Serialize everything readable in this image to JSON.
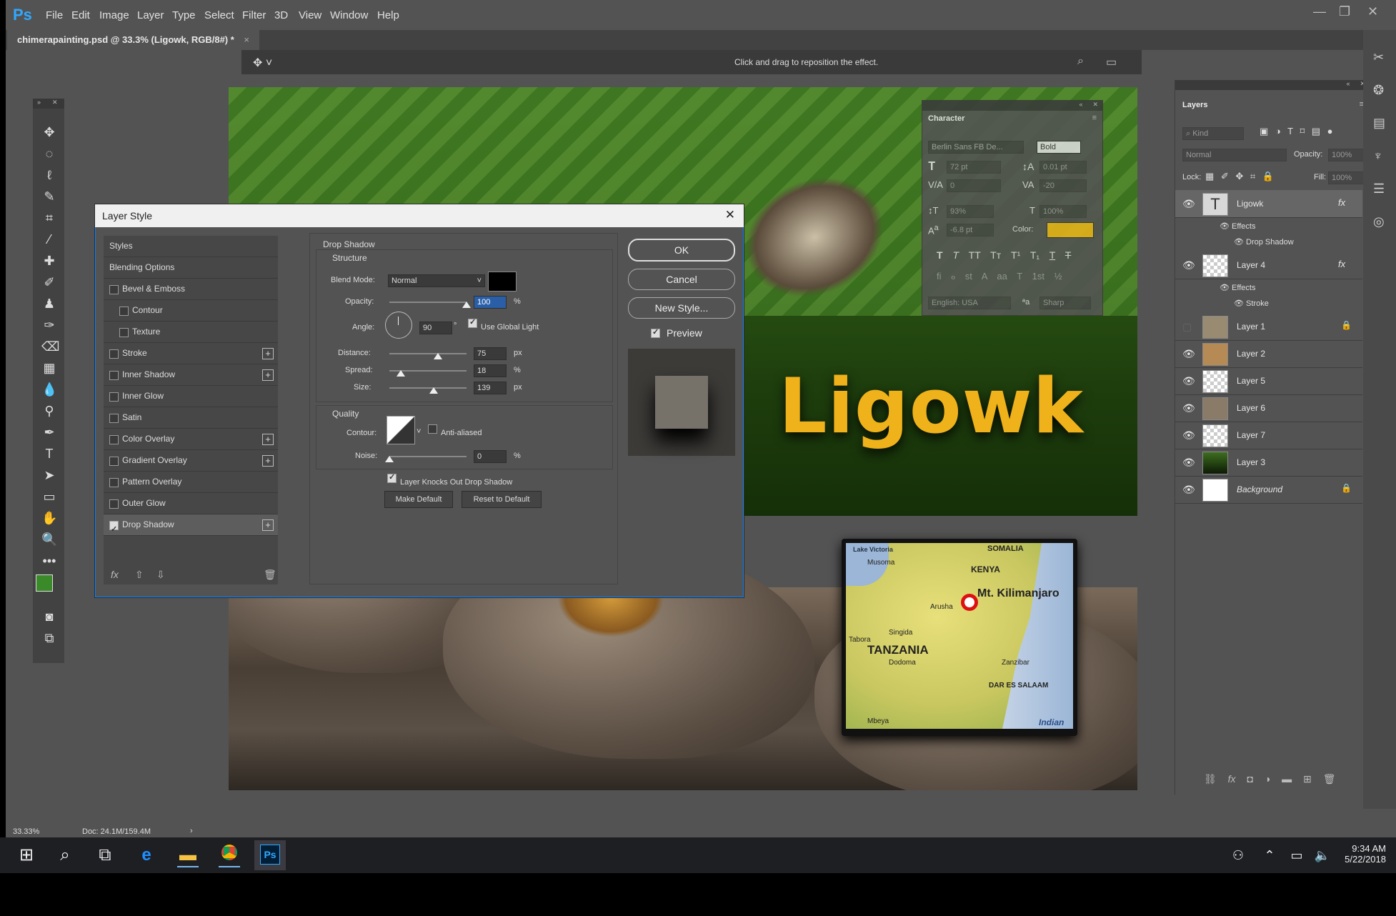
{
  "app": {
    "logo": "Ps",
    "menu": [
      "File",
      "Edit",
      "Image",
      "Layer",
      "Type",
      "Select",
      "Filter",
      "3D",
      "View",
      "Window",
      "Help"
    ],
    "document_tab": "chimerapainting.psd @ 33.3% (Ligowk, RGB/8#) *",
    "document_tab_close": "×",
    "options_hint": "Click and drag to reposition the effect.",
    "zoom": "33.33%",
    "doc_size": "Doc: 24.1M/159.4M"
  },
  "canvas": {
    "title_text": "Ligowk",
    "map_labels": {
      "lake_victoria": "Lake Victoria",
      "somalia": "SOMALIA",
      "kenya": "KENYA",
      "musoma": "Musoma",
      "mt_kili": "Mt. Kilimanjaro",
      "tanzania": "TANZANIA",
      "dodoma": "Dodoma",
      "dar": "DAR ES SALAAM",
      "indian": "Indian",
      "tabora": "Tabora",
      "arusha": "Arusha",
      "singida": "Singida",
      "zanzibar": "Zanzibar",
      "mbeya": "Mbeya"
    }
  },
  "dialog": {
    "title": "Layer Style",
    "close": "✕",
    "styles_list": [
      {
        "label": "Styles",
        "checkbox": false,
        "checked": false,
        "plus": false,
        "indent": false
      },
      {
        "label": "Blending Options",
        "checkbox": false,
        "checked": false,
        "plus": false,
        "indent": false
      },
      {
        "label": "Bevel & Emboss",
        "checkbox": true,
        "checked": false,
        "plus": false,
        "indent": false
      },
      {
        "label": "Contour",
        "checkbox": true,
        "checked": false,
        "plus": false,
        "indent": true
      },
      {
        "label": "Texture",
        "checkbox": true,
        "checked": false,
        "plus": false,
        "indent": true
      },
      {
        "label": "Stroke",
        "checkbox": true,
        "checked": false,
        "plus": true,
        "indent": false
      },
      {
        "label": "Inner Shadow",
        "checkbox": true,
        "checked": false,
        "plus": true,
        "indent": false
      },
      {
        "label": "Inner Glow",
        "checkbox": true,
        "checked": false,
        "plus": false,
        "indent": false
      },
      {
        "label": "Satin",
        "checkbox": true,
        "checked": false,
        "plus": false,
        "indent": false
      },
      {
        "label": "Color Overlay",
        "checkbox": true,
        "checked": false,
        "plus": true,
        "indent": false
      },
      {
        "label": "Gradient Overlay",
        "checkbox": true,
        "checked": false,
        "plus": true,
        "indent": false
      },
      {
        "label": "Pattern Overlay",
        "checkbox": true,
        "checked": false,
        "plus": false,
        "indent": false
      },
      {
        "label": "Outer Glow",
        "checkbox": true,
        "checked": false,
        "plus": false,
        "indent": false
      },
      {
        "label": "Drop Shadow",
        "checkbox": true,
        "checked": true,
        "plus": true,
        "indent": false
      }
    ],
    "footer_fx": "fx",
    "section_title": "Drop Shadow",
    "structure_title": "Structure",
    "blend_mode_label": "Blend Mode:",
    "blend_mode_value": "Normal",
    "shadow_color": "#000000",
    "opacity_label": "Opacity:",
    "opacity_value": "100",
    "percent": "%",
    "px": "px",
    "angle_label": "Angle:",
    "angle_value": "90",
    "degree": "°",
    "use_global_light": "Use Global Light",
    "distance_label": "Distance:",
    "distance_value": "75",
    "spread_label": "Spread:",
    "spread_value": "18",
    "size_label": "Size:",
    "size_value": "139",
    "quality_title": "Quality",
    "contour_label": "Contour:",
    "anti_aliased": "Anti-aliased",
    "noise_label": "Noise:",
    "noise_value": "0",
    "knockout": "Layer Knocks Out Drop Shadow",
    "make_default": "Make Default",
    "reset_default": "Reset to Default",
    "ok": "OK",
    "cancel": "Cancel",
    "new_style": "New Style...",
    "preview": "Preview"
  },
  "character": {
    "title": "Character",
    "font_family": "Berlin Sans FB De...",
    "font_style": "Bold",
    "size": "72 pt",
    "leading": "0.01 pt",
    "kerning": "0",
    "tracking": "-20",
    "vscale": "93%",
    "hscale": "100%",
    "baseline": "-6.8 pt",
    "color_label": "Color:",
    "text_color": "#e8b21a",
    "language": "English: USA",
    "antialias": "Sharp",
    "type_buttons": [
      "T",
      "T",
      "TT",
      "Tт",
      "T¹",
      "T₁",
      "T",
      "T"
    ],
    "ot_buttons": [
      "fi",
      "ℴ",
      "st",
      "A",
      "aa",
      "T",
      "1st",
      "½"
    ]
  },
  "layers": {
    "title": "Layers",
    "kind": "Kind",
    "blend": "Normal",
    "opacity_label": "Opacity:",
    "opacity_value": "100%",
    "lock_label": "Lock:",
    "fill_label": "Fill:",
    "fill_value": "100%",
    "effects_label": "Effects",
    "items": [
      {
        "name": "Ligowk",
        "fx": true,
        "visible": true,
        "locked": false,
        "italic": false,
        "effects": [
          "Drop Shadow"
        ],
        "thumb": "type"
      },
      {
        "name": "Layer 4",
        "fx": true,
        "visible": true,
        "locked": false,
        "italic": false,
        "effects": [
          "Stroke"
        ],
        "thumb": "checker"
      },
      {
        "name": "Layer 1",
        "fx": false,
        "visible": false,
        "locked": true,
        "italic": false,
        "effects": [],
        "thumb": "image"
      },
      {
        "name": "Layer 2",
        "fx": false,
        "visible": true,
        "locked": false,
        "italic": false,
        "effects": [],
        "thumb": "image"
      },
      {
        "name": "Layer 5",
        "fx": false,
        "visible": true,
        "locked": false,
        "italic": false,
        "effects": [],
        "thumb": "checker"
      },
      {
        "name": "Layer 6",
        "fx": false,
        "visible": true,
        "locked": false,
        "italic": false,
        "effects": [],
        "thumb": "image"
      },
      {
        "name": "Layer 7",
        "fx": false,
        "visible": true,
        "locked": false,
        "italic": false,
        "effects": [],
        "thumb": "checker"
      },
      {
        "name": "Layer 3",
        "fx": false,
        "visible": true,
        "locked": false,
        "italic": false,
        "effects": [],
        "thumb": "green"
      },
      {
        "name": "Background",
        "fx": false,
        "visible": true,
        "locked": true,
        "italic": true,
        "effects": [],
        "thumb": "white"
      }
    ]
  },
  "taskbar": {
    "time": "9:34 AM",
    "date": "5/22/2018"
  }
}
